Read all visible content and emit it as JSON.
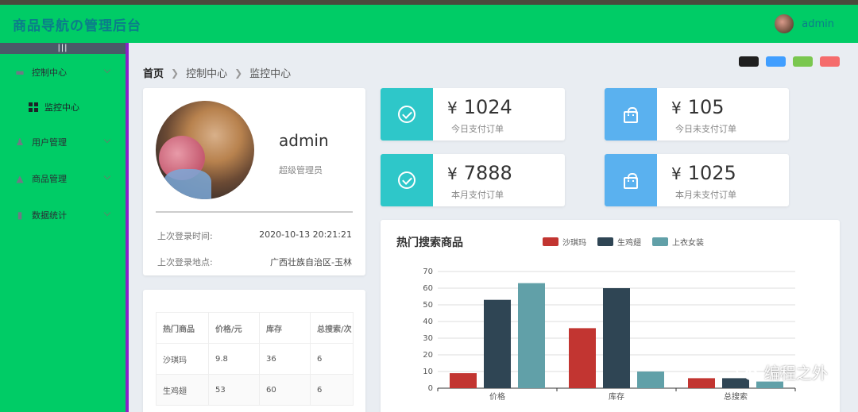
{
  "header": {
    "brand": "商品导航の管理后台",
    "username": "admin"
  },
  "sidebar": {
    "collapse_icon": "|||",
    "items": [
      {
        "label": "控制中心",
        "icon": "monitor-icon",
        "expanded": true
      },
      {
        "label": "监控中心",
        "icon": "grid-icon",
        "sub": true
      },
      {
        "label": "用户管理",
        "icon": "users-icon"
      },
      {
        "label": "商品管理",
        "icon": "box-icon"
      },
      {
        "label": "数据统计",
        "icon": "bar-chart-icon"
      }
    ]
  },
  "breadcrumb": {
    "home": "首页",
    "level1": "控制中心",
    "level2": "监控中心"
  },
  "theme_swatches": [
    "#1f1f1f",
    "#409eff",
    "#7ac74f",
    "#f56c6c"
  ],
  "profile": {
    "name": "admin",
    "role": "超级管理员",
    "last_login_time_label": "上次登录时间:",
    "last_login_time": "2020-10-13 20:21:21",
    "last_login_place_label": "上次登录地点:",
    "last_login_place": "广西壮族自治区-玉林"
  },
  "stats": [
    {
      "currency": "¥",
      "value": "1024",
      "label": "今日支付订单",
      "icon": "check-circle-icon",
      "color": "#2ec7c9"
    },
    {
      "currency": "¥",
      "value": "105",
      "label": "今日未支付订单",
      "icon": "shopping-bag-icon",
      "color": "#5ab1ef"
    },
    {
      "currency": "¥",
      "value": "7888",
      "label": "本月支付订单",
      "icon": "check-circle-icon",
      "color": "#2ec7c9"
    },
    {
      "currency": "¥",
      "value": "1025",
      "label": "本月未支付订单",
      "icon": "shopping-bag-icon",
      "color": "#5ab1ef"
    }
  ],
  "hot_table": {
    "headers": [
      "热门商品",
      "价格/元",
      "库存",
      "总搜索/次"
    ],
    "rows": [
      [
        "沙琪玛",
        "9.8",
        "36",
        "6"
      ],
      [
        "生鸡翅",
        "53",
        "60",
        "6"
      ]
    ]
  },
  "chart_data": {
    "type": "bar",
    "title": "热门搜索商品",
    "categories": [
      "价格",
      "库存",
      "总搜索"
    ],
    "series": [
      {
        "name": "沙琪玛",
        "color": "#c23531",
        "values": [
          9,
          36,
          6
        ]
      },
      {
        "name": "生鸡翅",
        "color": "#2f4554",
        "values": [
          53,
          60,
          6
        ]
      },
      {
        "name": "上衣女装",
        "color": "#61a0a8",
        "values": [
          63,
          10,
          4
        ]
      }
    ],
    "ylim": [
      0,
      70
    ],
    "yticks": [
      0,
      10,
      20,
      30,
      40,
      50,
      60,
      70
    ],
    "grid": true,
    "legend": "top"
  },
  "watermark": "编程之外"
}
